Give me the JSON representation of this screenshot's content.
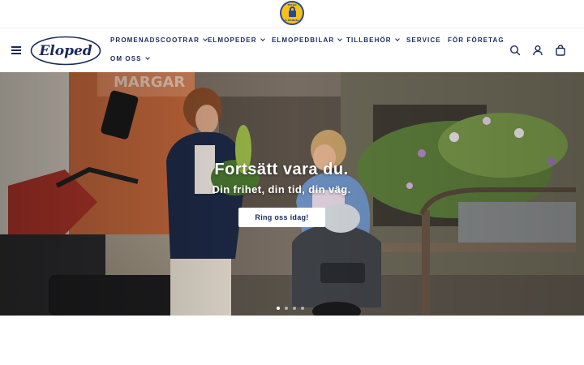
{
  "topbar": {
    "badge": {
      "icon": "trygg-e-handel-lock-icon",
      "line1": "TRYGG",
      "line2": "E-HANDEL"
    }
  },
  "header": {
    "menu_icon": "hamburger-menu-icon",
    "logo_text": "Eloped",
    "nav": [
      {
        "label": "PROMENADSCOOTRAR",
        "has_dropdown": true
      },
      {
        "label": "ELMOPEDER",
        "has_dropdown": true
      },
      {
        "label": "ELMOPEDBILAR",
        "has_dropdown": true
      },
      {
        "label": "TILLBEHÖR",
        "has_dropdown": true
      },
      {
        "label": "SERVICE",
        "has_dropdown": false
      },
      {
        "label": "FÖR FÖRETAG",
        "has_dropdown": false
      },
      {
        "label": "OM OSS",
        "has_dropdown": true
      }
    ],
    "icons": [
      "search-icon",
      "account-icon",
      "cart-icon"
    ]
  },
  "hero": {
    "title": "Fortsätt vara du.",
    "subtitle": "Din frihet, din tid, din väg.",
    "cta_label": "Ring oss idag!",
    "slides": 4,
    "active_slide": 1
  },
  "colors": {
    "brand_navy": "#1a2a5a",
    "badge_yellow": "#f4c01b",
    "badge_blue": "#2b4a8e"
  }
}
